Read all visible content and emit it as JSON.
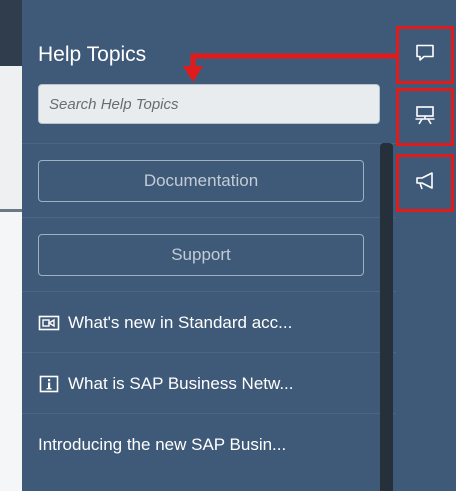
{
  "panel": {
    "title": "Help Topics",
    "search": {
      "placeholder": "Search Help Topics",
      "value": ""
    },
    "buttons": [
      {
        "label": "Documentation"
      },
      {
        "label": "Support"
      }
    ],
    "links": [
      {
        "label": "What's new in Standard acc...",
        "icon": "video-icon"
      },
      {
        "label": "What is SAP Business Netw...",
        "icon": "info-icon"
      },
      {
        "label": "Introducing the new SAP Busin...",
        "icon": ""
      }
    ]
  },
  "rail": {
    "items": [
      {
        "icon": "chat-bubble-icon"
      },
      {
        "icon": "presentation-board-icon"
      },
      {
        "icon": "megaphone-icon"
      }
    ]
  },
  "colors": {
    "panel_bg": "#3f5a78",
    "highlight": "#e01b1b",
    "text": "#ffffff"
  }
}
